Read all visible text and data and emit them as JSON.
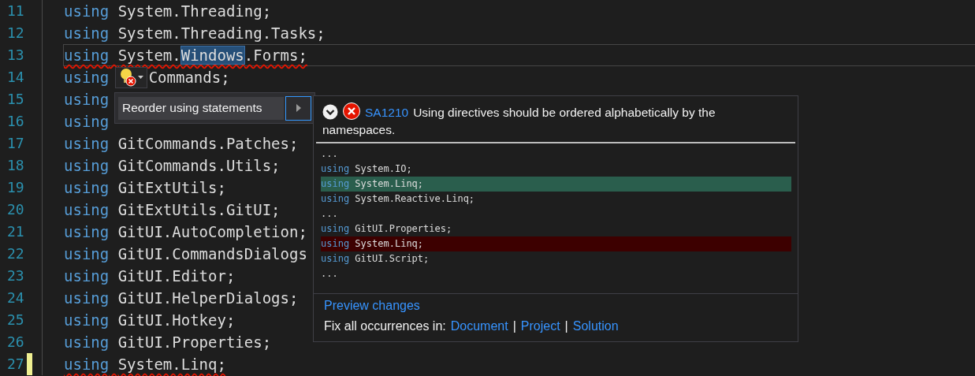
{
  "editor": {
    "lines": [
      {
        "number": "11",
        "keyword": "using",
        "parts": [
          {
            "text": "System.Threading;",
            "selected": false
          }
        ],
        "current": false,
        "squiggle": false,
        "modified": false,
        "bulb": false
      },
      {
        "number": "12",
        "keyword": "using",
        "parts": [
          {
            "text": "System.Threading.Tasks;",
            "selected": false
          }
        ],
        "current": false,
        "squiggle": false,
        "modified": false,
        "bulb": false
      },
      {
        "number": "13",
        "keyword": "using",
        "parts": [
          {
            "text": "System.",
            "selected": false
          },
          {
            "text": "Windows",
            "selected": true
          },
          {
            "text": ".Forms;",
            "selected": false
          }
        ],
        "current": true,
        "squiggle": true,
        "modified": false,
        "bulb": false
      },
      {
        "number": "14",
        "keyword": "using",
        "parts": [
          {
            "text": "Commands;",
            "selected": false
          }
        ],
        "current": false,
        "squiggle": false,
        "modified": false,
        "bulb": true
      },
      {
        "number": "15",
        "keyword": "using",
        "current": false,
        "squiggle": false,
        "modified": false,
        "bulb": false
      },
      {
        "number": "16",
        "keyword": "using",
        "current": false,
        "squiggle": false,
        "modified": false,
        "bulb": false
      },
      {
        "number": "17",
        "keyword": "using",
        "parts": [
          {
            "text": "GitCommands.Patches;",
            "selected": false
          }
        ],
        "current": false,
        "squiggle": false,
        "modified": false,
        "bulb": false
      },
      {
        "number": "18",
        "keyword": "using",
        "parts": [
          {
            "text": "GitCommands.Utils;",
            "selected": false
          }
        ],
        "current": false,
        "squiggle": false,
        "modified": false,
        "bulb": false
      },
      {
        "number": "19",
        "keyword": "using",
        "parts": [
          {
            "text": "GitExtUtils;",
            "selected": false
          }
        ],
        "current": false,
        "squiggle": false,
        "modified": false,
        "bulb": false
      },
      {
        "number": "20",
        "keyword": "using",
        "parts": [
          {
            "text": "GitExtUtils.GitUI;",
            "selected": false
          }
        ],
        "current": false,
        "squiggle": false,
        "modified": false,
        "bulb": false
      },
      {
        "number": "21",
        "keyword": "using",
        "parts": [
          {
            "text": "GitUI.AutoCompletion;",
            "selected": false
          }
        ],
        "current": false,
        "squiggle": false,
        "modified": false,
        "bulb": false
      },
      {
        "number": "22",
        "keyword": "using",
        "parts": [
          {
            "text": "GitUI.CommandsDialogs",
            "selected": false
          }
        ],
        "current": false,
        "squiggle": false,
        "modified": false,
        "bulb": false
      },
      {
        "number": "23",
        "keyword": "using",
        "parts": [
          {
            "text": "GitUI.Editor;",
            "selected": false
          }
        ],
        "current": false,
        "squiggle": false,
        "modified": false,
        "bulb": false
      },
      {
        "number": "24",
        "keyword": "using",
        "parts": [
          {
            "text": "GitUI.HelperDialogs;",
            "selected": false
          }
        ],
        "current": false,
        "squiggle": false,
        "modified": false,
        "bulb": false
      },
      {
        "number": "25",
        "keyword": "using",
        "parts": [
          {
            "text": "GitUI.Hotkey;",
            "selected": false
          }
        ],
        "current": false,
        "squiggle": false,
        "modified": false,
        "bulb": false
      },
      {
        "number": "26",
        "keyword": "using",
        "parts": [
          {
            "text": "GitUI.Properties;",
            "selected": false
          }
        ],
        "current": false,
        "squiggle": false,
        "modified": false,
        "bulb": false
      },
      {
        "number": "27",
        "keyword": "using",
        "parts": [
          {
            "text": "System.Linq;",
            "selected": false
          }
        ],
        "current": false,
        "squiggle": true,
        "modified": true,
        "bulb": false
      }
    ]
  },
  "quick_actions": {
    "items": [
      {
        "label": "Reorder using statements",
        "selected": true
      }
    ]
  },
  "preview": {
    "code": "SA1210",
    "message": "Using directives should be ordered alphabetically by the namespaces.",
    "lines": [
      {
        "kind": "ellipsis",
        "text": "..."
      },
      {
        "kind": "code",
        "keyword": "using",
        "text": "System.IO;",
        "added": false,
        "removed": false
      },
      {
        "kind": "code",
        "keyword": "using",
        "text": "System.Linq;",
        "added": true,
        "removed": false
      },
      {
        "kind": "code",
        "keyword": "using",
        "text": "System.Reactive.Linq;",
        "added": false,
        "removed": false
      },
      {
        "kind": "ellipsis",
        "text": "..."
      },
      {
        "kind": "code",
        "keyword": "using",
        "text": "GitUI.Properties;",
        "added": false,
        "removed": false
      },
      {
        "kind": "code",
        "keyword": "using",
        "text": "System.Linq;",
        "added": false,
        "removed": true
      },
      {
        "kind": "code",
        "keyword": "using",
        "text": "GitUI.Script;",
        "added": false,
        "removed": false
      },
      {
        "kind": "ellipsis",
        "text": "..."
      }
    ],
    "preview_link": "Preview changes",
    "fix_all_label": "Fix all occurrences in:",
    "fix_scopes": [
      {
        "label": "Document"
      },
      {
        "separator": "|",
        "label": "Project"
      },
      {
        "separator": "|",
        "label": "Solution"
      }
    ]
  }
}
